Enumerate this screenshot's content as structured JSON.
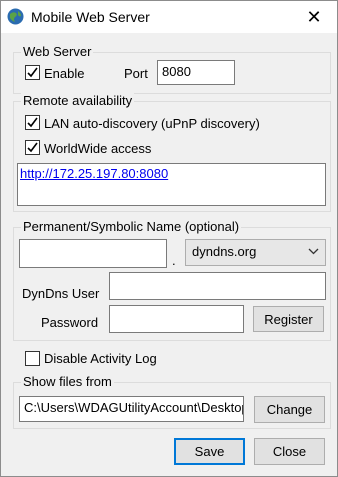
{
  "window": {
    "title": "Mobile Web Server",
    "close_glyph": "✕"
  },
  "web_server": {
    "legend": "Web Server",
    "enable_label": "Enable",
    "enable_checked": true,
    "port_label": "Port",
    "port_value": "8080"
  },
  "remote": {
    "legend": "Remote availability",
    "lan_label": "LAN auto-discovery (uPnP discovery)",
    "lan_checked": true,
    "worldwide_label": "WorldWide access",
    "worldwide_checked": true,
    "url": "http://172.25.197.80:8080"
  },
  "permanent": {
    "legend": "Permanent/Symbolic Name (optional)",
    "name_value": "",
    "dot": ".",
    "domain_selected": "dyndns.org",
    "dyndns_user_label": "DynDns User",
    "dyndns_user_value": "",
    "password_label": "Password",
    "password_value": "",
    "register_label": "Register"
  },
  "activity": {
    "disable_log_label": "Disable Activity Log",
    "disable_log_checked": false
  },
  "files": {
    "legend": "Show files from",
    "path_value": "C:\\Users\\WDAGUtilityAccount\\Desktop",
    "change_label": "Change"
  },
  "footer": {
    "save_label": "Save",
    "close_label": "Close"
  },
  "icons": [
    "globe-icon",
    "close-icon",
    "checkmark-icon",
    "chevron-down-icon"
  ],
  "colors": {
    "link": "#0000ee",
    "default_button_border": "#0078d7",
    "window_bg": "#f0f0f0"
  }
}
